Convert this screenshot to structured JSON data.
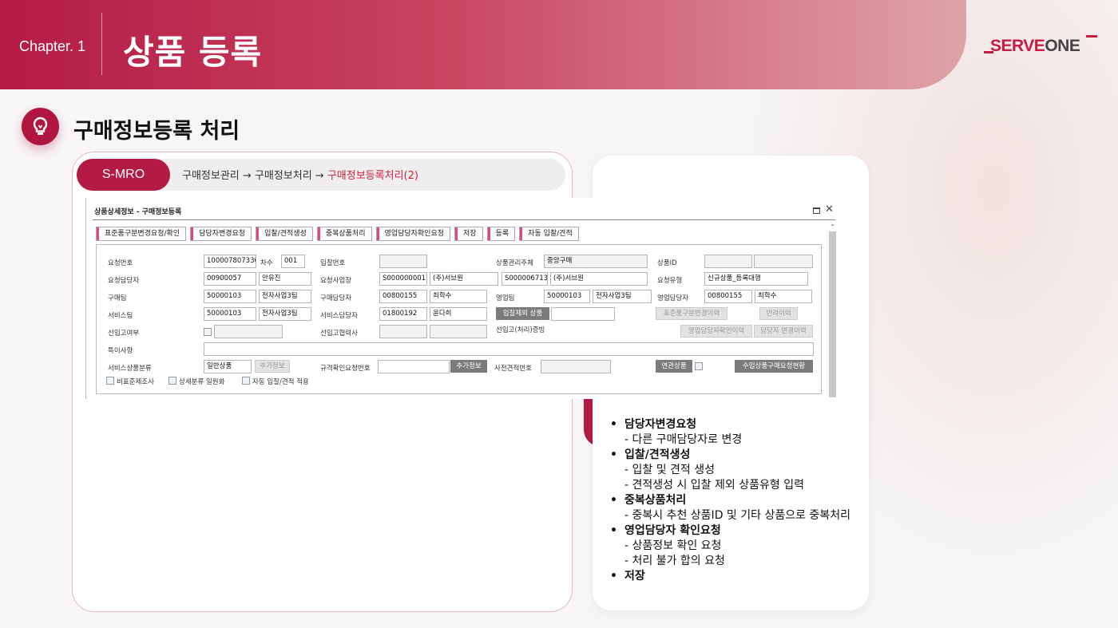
{
  "header": {
    "chapter": "Chapter. 1",
    "title": "상품 등록",
    "logo": "SERVEONE"
  },
  "section": {
    "title": "구매정보등록 처리",
    "icon": "lightbulb-icon"
  },
  "breadcrumb": {
    "system": "S-MRO",
    "path": "구매정보관리 → 구매정보처리 → ",
    "active": "구매정보등록처리(2)"
  },
  "window": {
    "title": "상품상세정보 - 구매정보등록",
    "tabs": [
      "표준품구분변경요청/확인",
      "담당자변경요청",
      "입찰/견적생성",
      "중복상품처리",
      "영업담당자확인요청",
      "저장",
      "등록",
      "자동 입찰/견적"
    ],
    "labels": {
      "req_no": "요청번호",
      "seq": "차수",
      "bid_no": "입찰번호",
      "mgmt": "상품관리주체",
      "prod_id": "상품ID",
      "req_mgr": "요청담당자",
      "req_site": "요청사업장",
      "req_type": "요청유형",
      "buy_team": "구매팀",
      "buy_mgr": "구매담당자",
      "sales_team": "영업팀",
      "sales_mgr": "영업담당자",
      "svc_team": "서비스팀",
      "svc_mgr": "서비스담당자",
      "pre_in": "선입고여부",
      "pre_partner": "선입고협력사",
      "pre_proof": "선입고(처리)증빙",
      "special": "특이사항",
      "svc_class": "서비스상품분류",
      "spec_no": "규격확인요청번호",
      "pre_quote": "사전견적번호"
    },
    "values": {
      "req_no": "100007807330",
      "seq": "001",
      "mgmt": "중앙구매",
      "req_mgr_code": "00900057",
      "req_mgr_name": "안유진",
      "req_site_code1": "S000000001",
      "req_site_name1": "(주)서브원",
      "req_site_code2": "S000006713",
      "req_site_name2": "(주)서브원",
      "req_type": "신규상품_등록대행",
      "buy_team_code": "50000103",
      "buy_team_name": "전자사업3팀",
      "buy_mgr_code": "00800155",
      "buy_mgr_name": "최학수",
      "sales_team_code": "50000103",
      "sales_team_name": "전자사업3팀",
      "sales_mgr_code": "00800155",
      "sales_mgr_name": "최학수",
      "svc_team_code": "50000103",
      "svc_team_name": "전자사업3팀",
      "svc_mgr_code": "01800192",
      "svc_mgr_name": "윤다희",
      "svc_class": "일반상품"
    },
    "buttons": {
      "bid_exclude": "입찰제외 상품",
      "std_history": "표준품구분변경이력",
      "return_history": "반려이력",
      "sales_confirm_history": "영업담당자확인이력",
      "mgr_change_history": "담당자 변경이력",
      "add_info1": "추가정보",
      "add_info2": "추가정보",
      "related": "연관상품",
      "import_status": "수입상품구매요청현황"
    },
    "checkboxes": [
      "비표준제조사",
      "상세분류 일원화",
      "자동 입찰/견적 적용"
    ]
  },
  "notes": [
    {
      "title": "담당자변경요청",
      "subs": [
        "- 다른 구매담당자로 변경"
      ]
    },
    {
      "title": "입찰/견적생성",
      "subs": [
        "- 입찰 및 견적 생성",
        "- 견적생성 시 입찰 제외 상품유형 입력"
      ]
    },
    {
      "title": "중복상품처리",
      "subs": [
        "- 중복시 추천 상품ID 및 기타 상품으로 중복처리"
      ]
    },
    {
      "title": "영업담당자 확인요청",
      "subs": [
        "- 상품정보 확인 요청",
        "- 처리 불가 합의 요청"
      ]
    },
    {
      "title": "저장",
      "subs": []
    }
  ]
}
